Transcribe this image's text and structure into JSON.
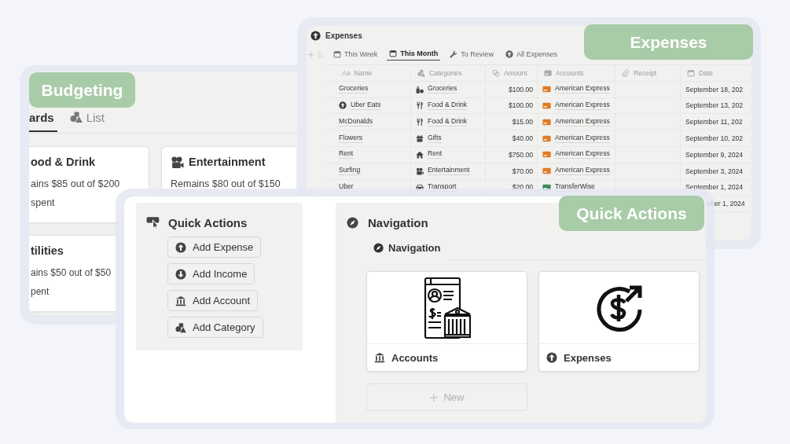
{
  "budgeting_view": {
    "label": "Budgeting",
    "tabs": [
      {
        "label": "ards",
        "selected": true
      },
      {
        "label": "List",
        "selected": false
      }
    ],
    "cards": [
      {
        "title": "ood & Drink",
        "lines": [
          "ains $85 out of $200",
          "spent"
        ]
      },
      {
        "title": "Entertainment",
        "lines": [
          "Remains $80 out of $150"
        ]
      },
      {
        "title": "tilities",
        "lines": [
          "ains $50 out of $50",
          "pent"
        ]
      }
    ]
  },
  "expenses_view": {
    "label": "Expenses",
    "title": "Expenses",
    "tabs": [
      {
        "label": "This Week",
        "selected": false
      },
      {
        "label": "This Month",
        "selected": true
      },
      {
        "label": "To Review",
        "selected": false
      },
      {
        "label": "All Expenses",
        "selected": false
      }
    ],
    "columns": [
      {
        "label": "Name",
        "glyph": "Aa"
      },
      {
        "label": "Categories"
      },
      {
        "label": "Amount"
      },
      {
        "label": "Accounts"
      },
      {
        "label": "Receipt"
      },
      {
        "label": "Date"
      }
    ],
    "rows": [
      {
        "name": "Groceries",
        "category": "Groceries",
        "amount": "$100.00",
        "account": "American Express",
        "color": "#e07b24",
        "date": "September 18, 202"
      },
      {
        "name": "Uber Eats",
        "category": "Food & Drink",
        "amount": "$100.00",
        "account": "American Express",
        "color": "#e07b24",
        "date": "September 13, 202"
      },
      {
        "name": "McDonalds",
        "category": "Food & Drink",
        "amount": "$15.00",
        "account": "American Express",
        "color": "#e07b24",
        "date": "September 11, 202"
      },
      {
        "name": "Flowers",
        "category": "Gifts",
        "amount": "$40.00",
        "account": "American Express",
        "color": "#e07b24",
        "date": "September 10, 202"
      },
      {
        "name": "Rent",
        "category": "Rent",
        "amount": "$750.00",
        "account": "American Express",
        "color": "#e07b24",
        "date": "September 9, 2024"
      },
      {
        "name": "Surfing",
        "category": "Entertainment",
        "amount": "$70.00",
        "account": "American Express",
        "color": "#e07b24",
        "date": "September 3, 2024"
      },
      {
        "name": "Uber",
        "category": "Transport",
        "amount": "$20.00",
        "account": "TransferWise",
        "color": "#3b8a5a",
        "date": "September 1, 2024"
      },
      {
        "date": "mber 1, 2024"
      }
    ]
  },
  "quick_actions_page": {
    "label": "Quick Actions",
    "actions_title": "Quick Actions",
    "actions": [
      "Add Expense",
      "Add Income",
      "Add Account",
      "Add Category"
    ],
    "navigation_title": "Navigation",
    "navigation_subtitle": "Navigation",
    "nav_cards": [
      "Accounts",
      "Expenses"
    ],
    "new_button": "New"
  }
}
